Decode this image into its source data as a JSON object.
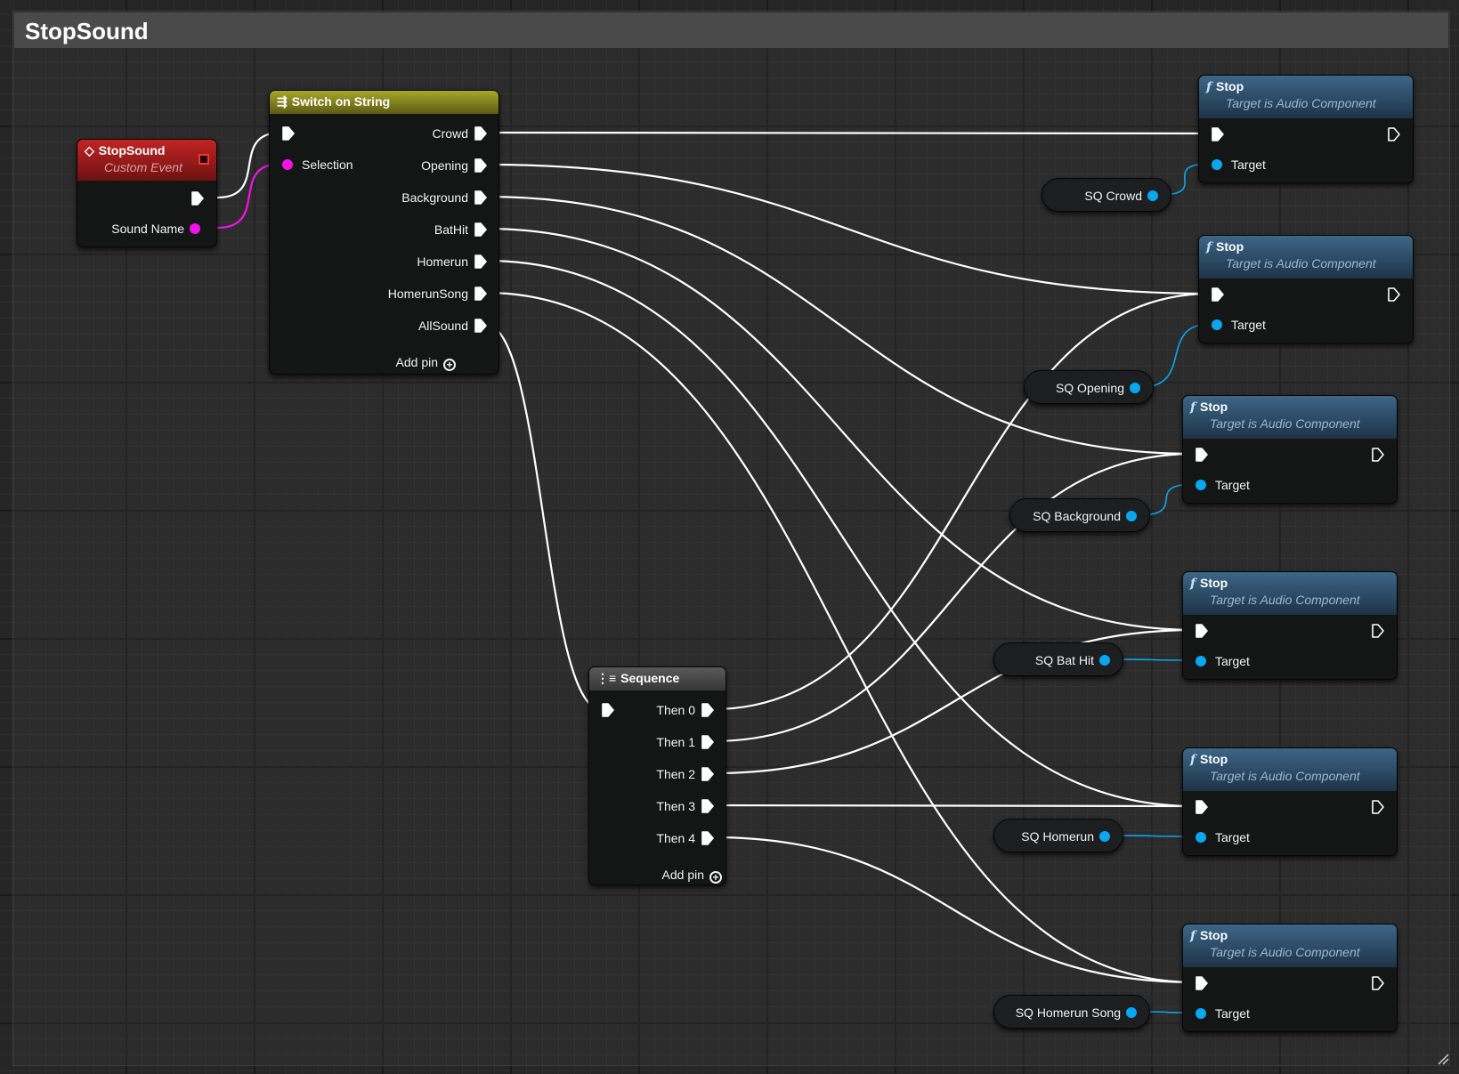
{
  "comment": {
    "title": "StopSound"
  },
  "event_node": {
    "title": "StopSound",
    "subtitle": "Custom Event",
    "pin_sound_name": "Sound Name",
    "icon": "event-diamond-icon"
  },
  "switch_node": {
    "title": "Switch on String",
    "icon": "switch-icon",
    "selection_label": "Selection",
    "outputs": [
      "Crowd",
      "Opening",
      "Background",
      "BatHit",
      "Homerun",
      "HomerunSong",
      "AllSound"
    ],
    "add_pin": "Add pin"
  },
  "sequence_node": {
    "title": "Sequence",
    "icon": "sequence-icon",
    "outputs": [
      "Then 0",
      "Then 1",
      "Then 2",
      "Then 3",
      "Then 4"
    ],
    "add_pin": "Add pin"
  },
  "stop_nodes": [
    {
      "title": "Stop",
      "subtitle": "Target is Audio Component",
      "target_label": "Target"
    },
    {
      "title": "Stop",
      "subtitle": "Target is Audio Component",
      "target_label": "Target"
    },
    {
      "title": "Stop",
      "subtitle": "Target is Audio Component",
      "target_label": "Target"
    },
    {
      "title": "Stop",
      "subtitle": "Target is Audio Component",
      "target_label": "Target"
    },
    {
      "title": "Stop",
      "subtitle": "Target is Audio Component",
      "target_label": "Target"
    },
    {
      "title": "Stop",
      "subtitle": "Target is Audio Component",
      "target_label": "Target"
    }
  ],
  "function_icon": "f",
  "variables": [
    "SQ Crowd",
    "SQ Opening",
    "SQ Background",
    "SQ Bat Hit",
    "SQ Homerun",
    "SQ Homerun Song"
  ],
  "colors": {
    "exec_wire": "#ffffff",
    "string_wire": "#f312e8",
    "object_wire": "#09a8ee",
    "event_header": "#a11a1a",
    "switch_header": "#8a8a1e",
    "function_header": "#2d4a63",
    "sequence_header": "#4a4a4a"
  }
}
